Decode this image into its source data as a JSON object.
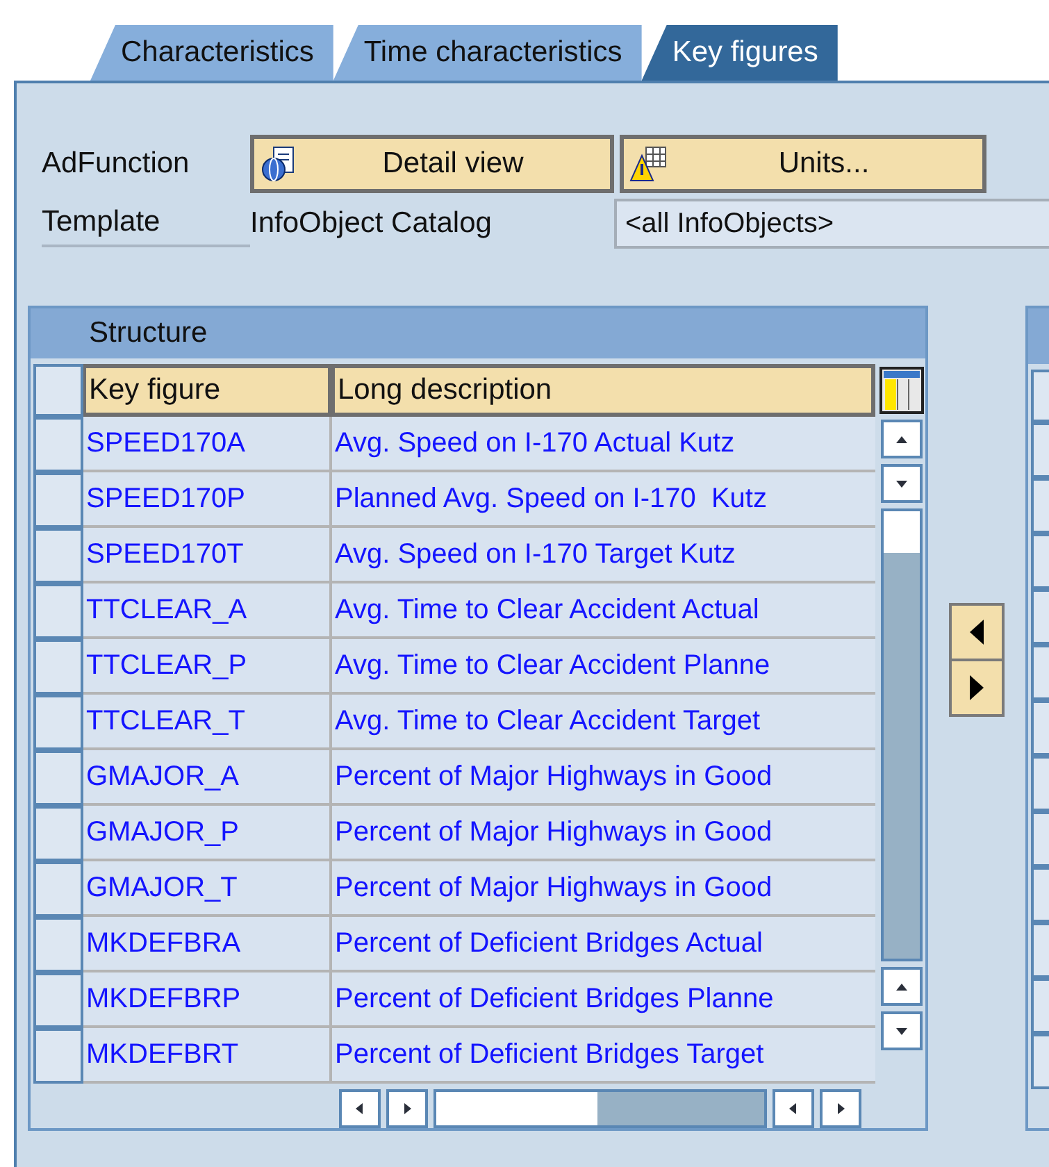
{
  "tabs": [
    {
      "label": "Characteristics",
      "selected": false
    },
    {
      "label": "Time characteristics",
      "selected": false
    },
    {
      "label": "Key figures",
      "selected": true
    }
  ],
  "ad_function": {
    "label": "AdFunction",
    "buttons": [
      {
        "label": "Detail view",
        "kind": "detail"
      },
      {
        "label": "Units...",
        "kind": "units"
      }
    ]
  },
  "template": {
    "label": "Template",
    "source": "InfoObject Catalog",
    "value": "<all InfoObjects>"
  },
  "structure": {
    "title": "Structure",
    "columns": [
      "Key figure",
      "Long description"
    ],
    "rows": [
      {
        "key_figure": "SPEED170A",
        "description": "Avg. Speed on I-170 Actual Kutz"
      },
      {
        "key_figure": "SPEED170P",
        "description": "Planned Avg. Speed on I-170  Kutz"
      },
      {
        "key_figure": "SPEED170T",
        "description": "Avg. Speed on I-170 Target Kutz"
      },
      {
        "key_figure": "TTCLEAR_A",
        "description": "Avg. Time to Clear Accident Actual"
      },
      {
        "key_figure": "TTCLEAR_P",
        "description": "Avg. Time to Clear Accident Planne"
      },
      {
        "key_figure": "TTCLEAR_T",
        "description": "Avg. Time to Clear Accident Target"
      },
      {
        "key_figure": "GMAJOR_A",
        "description": "Percent of Major Highways in Good"
      },
      {
        "key_figure": "GMAJOR_P",
        "description": "Percent of Major Highways in Good"
      },
      {
        "key_figure": "GMAJOR_T",
        "description": "Percent of Major Highways in Good"
      },
      {
        "key_figure": "MKDEFBRA",
        "description": "Percent of Deficient Bridges Actual"
      },
      {
        "key_figure": "MKDEFBRP",
        "description": "Percent of Deficient Bridges Planne"
      },
      {
        "key_figure": "MKDEFBRT",
        "description": "Percent of Deficient Bridges Target"
      }
    ]
  }
}
